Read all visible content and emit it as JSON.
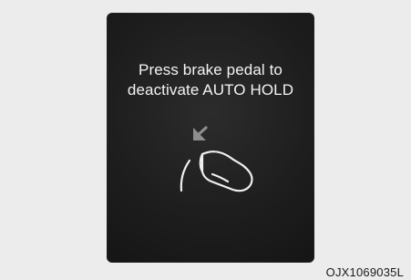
{
  "display": {
    "message": "Press brake pedal to\ndeactivate AUTO HOLD"
  },
  "icons": {
    "arrow": "down-arrow-icon",
    "pedal": "brake-pedal-foot-icon"
  },
  "figure": {
    "code": "OJX1069035L"
  }
}
